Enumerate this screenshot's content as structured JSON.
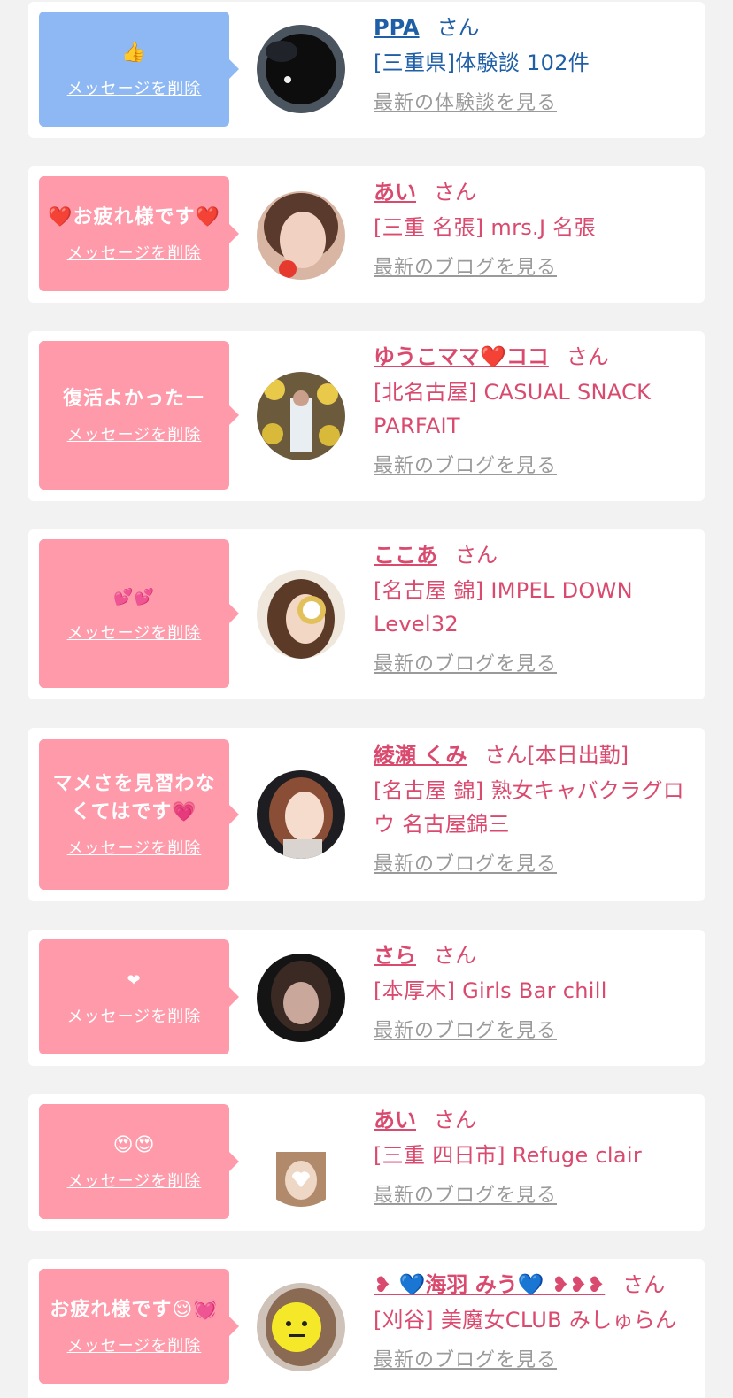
{
  "delete_label": "メッセージを削除",
  "san_label": "さん",
  "colors": {
    "pink_bubble": "#ff9aaa",
    "blue_bubble": "#8db8f3",
    "name_pink": "#d94a6e",
    "name_blue": "#1f5fa6",
    "link_gray": "#9a9a9a"
  },
  "items": [
    {
      "message": "👍",
      "name": "PPA",
      "suffix": "",
      "shop": "[三重県]体験談 102件",
      "latest": "最新の体験談を見る"
    },
    {
      "message": "❤️お疲れ様です❤️",
      "name": "あい",
      "suffix": "",
      "shop": "[三重 名張] mrs.J 名張",
      "latest": "最新のブログを見る"
    },
    {
      "message": "復活よかったー",
      "name": "ゆうこママ❤️ココ",
      "suffix": "",
      "shop": "[北名古屋] CASUAL SNACK PARFAIT",
      "latest": "最新のブログを見る"
    },
    {
      "message": "💕💕",
      "name": "ここあ",
      "suffix": "",
      "shop": "[名古屋 錦] IMPEL DOWN Level32",
      "latest": "最新のブログを見る"
    },
    {
      "message": "マメさを見習わなくてはです💗",
      "name": "綾瀬 くみ",
      "suffix": "[本日出勤]",
      "shop": "[名古屋 錦] 熟女キャバクラグロウ 名古屋錦三",
      "latest": "最新のブログを見る"
    },
    {
      "message": "❤",
      "name": "さら",
      "suffix": "",
      "shop": "[本厚木] Girls Bar chill",
      "latest": "最新のブログを見る"
    },
    {
      "message": "😍😍",
      "name": "あい",
      "suffix": "",
      "shop": "[三重 四日市] Refuge clair",
      "latest": "最新のブログを見る"
    },
    {
      "message": "お疲れ様です😌💓",
      "name": "❥ 💙海羽 みう💙 ❥❥❥",
      "suffix": "",
      "shop": "[刈谷] 美魔女CLUB みしゅらん",
      "latest": "最新のブログを見る"
    }
  ]
}
